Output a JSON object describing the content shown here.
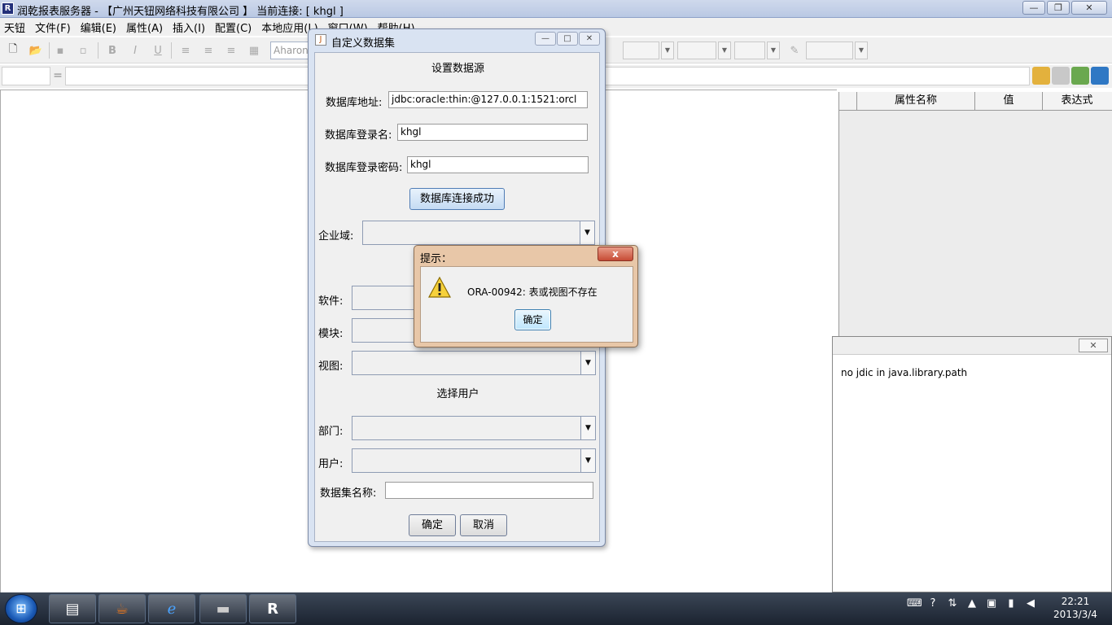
{
  "window": {
    "title": "润乾报表服务器 - 【广州天钮网络科技有限公司 】  当前连接: [ khgl ]",
    "app_icon": "R",
    "minimize": "—",
    "maximize": "❐",
    "close": "✕"
  },
  "menu": [
    "天钮",
    "文件(F)",
    "编辑(E)",
    "属性(A)",
    "插入(I)",
    "配置(C)",
    "本地应用(L)",
    "窗口(W)",
    "帮助(H)"
  ],
  "toolbar": {
    "font_name": "Aharoni",
    "bold": "B",
    "italic": "I",
    "underline": "U"
  },
  "formula_bar": {
    "equals": "="
  },
  "property_panel": {
    "columns": [
      "属性名称",
      "值",
      "表达式"
    ]
  },
  "console": {
    "close": "✕",
    "message": "no jdic in java.library.path"
  },
  "dialog": {
    "title": "自定义数据集",
    "java_icon": "J",
    "min": "—",
    "max": "□",
    "close": "✕",
    "section_datasource": "设置数据源",
    "db_url_label": "数据库地址:",
    "db_url_value": "jdbc:oracle:thin:@127.0.0.1:1521:orcl",
    "db_user_label": "数据库登录名:",
    "db_user_value": "khgl",
    "db_password_label": "数据库登录密码:",
    "db_password_value": "khgl",
    "connect_button": "数据库连接成功",
    "enterprise_label": "企业域:",
    "software_label": "软件:",
    "module_label": "模块:",
    "view_label": "视图:",
    "section_user": "选择用户",
    "department_label": "部门:",
    "user_label": "用户:",
    "dataset_name_label": "数据集名称:",
    "dataset_name_value": "",
    "ok": "确定",
    "cancel": "取消"
  },
  "alert": {
    "title": "提示：",
    "close": "x",
    "message": "ORA-00942: 表或视图不存在",
    "ok": "确定"
  },
  "taskbar": {
    "start": "⊞",
    "time": "22:21",
    "date": "2013/3/4"
  }
}
